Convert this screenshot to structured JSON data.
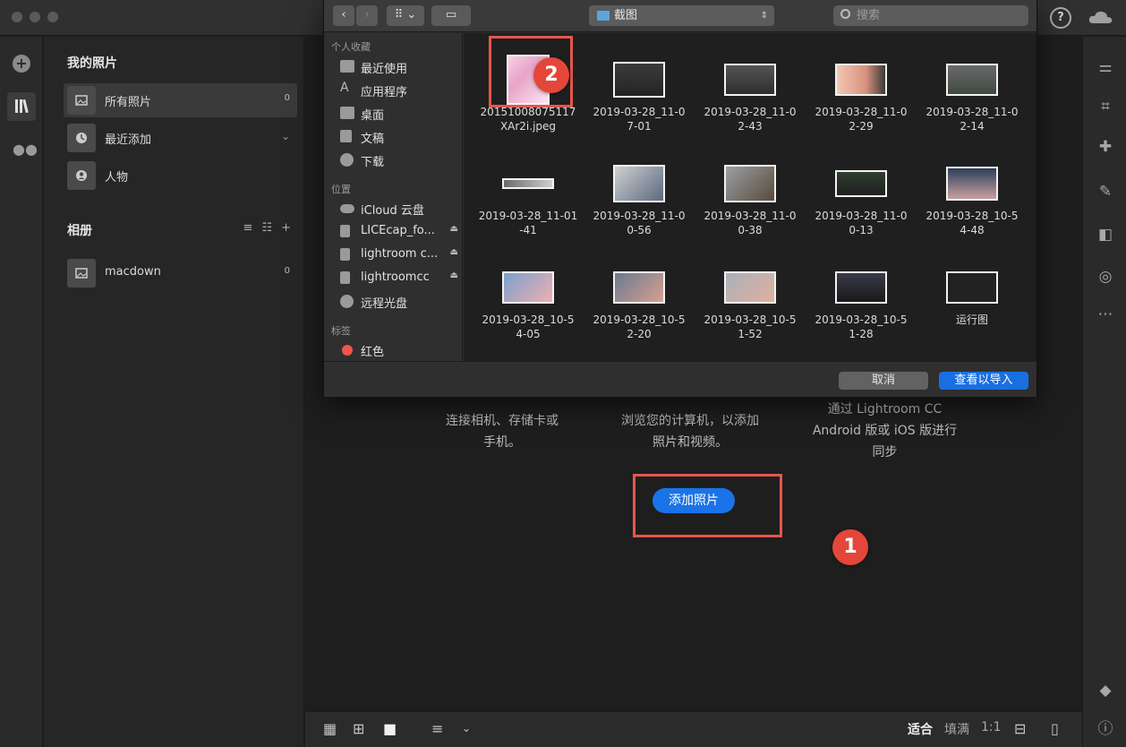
{
  "sidebar": {
    "my_photos_title": "我的照片",
    "items": [
      {
        "label": "所有照片",
        "count": "0"
      },
      {
        "label": "最近添加"
      },
      {
        "label": "人物"
      }
    ],
    "albums_title": "相册",
    "albums": [
      {
        "label": "macdown",
        "count": "0"
      }
    ]
  },
  "main": {
    "col1": "连接相机、存储卡或手机。",
    "col1_line1": "连接相机、存储卡或",
    "col1_line2": "手机。",
    "col2_line1": "浏览您的计算机，以添加",
    "col2_line2": "照片和视频。",
    "col3_line1": "通过 Lightroom CC",
    "col3_line2": "Android 版或 iOS 版进行",
    "col3_line3": "同步",
    "add_button": "添加照片",
    "step1": "1",
    "step2": "2"
  },
  "bottombar": {
    "fit": "适合",
    "fill": "填满",
    "ratio": "1:1"
  },
  "dialog": {
    "path": "截图",
    "search_placeholder": "搜索",
    "favorites_header": "个人收藏",
    "favorites": [
      "最近使用",
      "应用程序",
      "桌面",
      "文稿",
      "下载"
    ],
    "locations_header": "位置",
    "locations": [
      "iCloud 云盘",
      "LICEcap_fo...",
      "lightroom c...",
      "lightroomcc",
      "远程光盘"
    ],
    "tags_header": "标签",
    "tags": [
      "红色"
    ],
    "files": [
      {
        "line1": "20151008075117",
        "line2": "XAr2i.jpeg"
      },
      {
        "line1": "2019-03-28_11-0",
        "line2": "7-01"
      },
      {
        "line1": "2019-03-28_11-0",
        "line2": "2-43"
      },
      {
        "line1": "2019-03-28_11-0",
        "line2": "2-29"
      },
      {
        "line1": "2019-03-28_11-0",
        "line2": "2-14"
      },
      {
        "line1": "2019-03-28_11-01",
        "line2": "-41"
      },
      {
        "line1": "2019-03-28_11-0",
        "line2": "0-56"
      },
      {
        "line1": "2019-03-28_11-0",
        "line2": "0-38"
      },
      {
        "line1": "2019-03-28_11-0",
        "line2": "0-13"
      },
      {
        "line1": "2019-03-28_10-5",
        "line2": "4-48"
      },
      {
        "line1": "2019-03-28_10-5",
        "line2": "4-05"
      },
      {
        "line1": "2019-03-28_10-5",
        "line2": "2-20"
      },
      {
        "line1": "2019-03-28_10-5",
        "line2": "1-52"
      },
      {
        "line1": "2019-03-28_10-5",
        "line2": "1-28"
      },
      {
        "line1": "运行图",
        "line2": ""
      }
    ],
    "cancel": "取消",
    "confirm": "查看以导入"
  },
  "colors": {
    "accent": "#1a73e8",
    "highlight": "#e5564a",
    "background": "#1e1e1e"
  }
}
